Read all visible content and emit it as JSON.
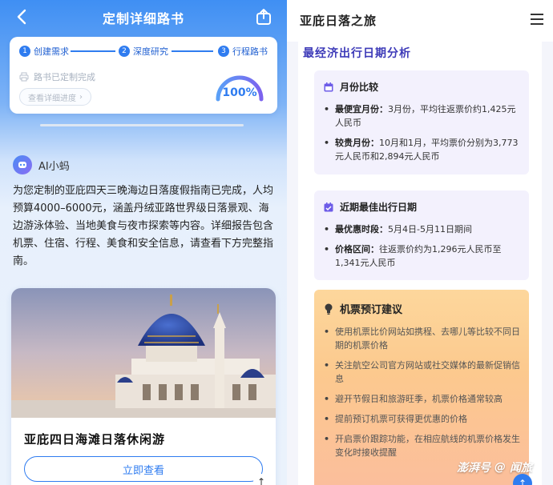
{
  "left": {
    "title": "定制详细路书",
    "steps": [
      {
        "num": "1",
        "label": "创建需求"
      },
      {
        "num": "2",
        "label": "深度研究"
      },
      {
        "num": "3",
        "label": "行程路书"
      }
    ],
    "status_text": "路书已定制完成",
    "detail_button": "查看详细进度",
    "progress": {
      "value": 1.0,
      "label": "100%"
    },
    "ai": {
      "name": "AI小蚂",
      "message": "为您定制的亚庇四天三晚海边日落度假指南已完成，人均预算4000–6000元，涵盖丹绒亚路世界级日落景观、海边游泳体验、当地美食与夜市探索等内容。详细报告包含机票、住宿、行程、美食和安全信息，请查看下方完整指南。"
    },
    "card": {
      "title": "亚庇四日海滩日落休闲游",
      "button": "立即查看"
    },
    "scroll_top_icon": "↑"
  },
  "right": {
    "header_title": "亚庇日落之旅",
    "section_title": "最经济出行日期分析",
    "month_card": {
      "title": "月份比较",
      "items": [
        {
          "label": "最便宜月份：",
          "text": "3月份，平均往返票价约1,425元人民币"
        },
        {
          "label": "较贵月份：",
          "text": "10月和1月，平均票价分别为3,773元人民币和2,894元人民币"
        }
      ]
    },
    "date_card": {
      "title": "近期最佳出行日期",
      "items": [
        {
          "label": "最优惠时段：",
          "text": "5月4日-5月11日期间"
        },
        {
          "label": "价格区间：",
          "text": "往返票价约为1,296元人民币至1,341元人民币"
        }
      ]
    },
    "suggest_card": {
      "title": "机票预订建议",
      "items": [
        "使用机票比价网站如携程、去哪儿等比较不同日期的机票价格",
        "关注航空公司官方网站或社交媒体的最新促销信息",
        "避开节假日和旅游旺季，机票价格通常较高",
        "提前预订机票可获得更优惠的价格",
        "开启票价跟踪功能，在相应航线的机票价格发生变化时接收提醒"
      ]
    },
    "watermark": {
      "left": "澎湃号",
      "right": "闻旅"
    },
    "scroll_top_icon": "↑"
  },
  "colors": {
    "accent": "#2f7cf0",
    "section_title": "#3d3ab8",
    "card_bg": "#f3f1fd",
    "suggest_bg": "#fcc98e"
  }
}
